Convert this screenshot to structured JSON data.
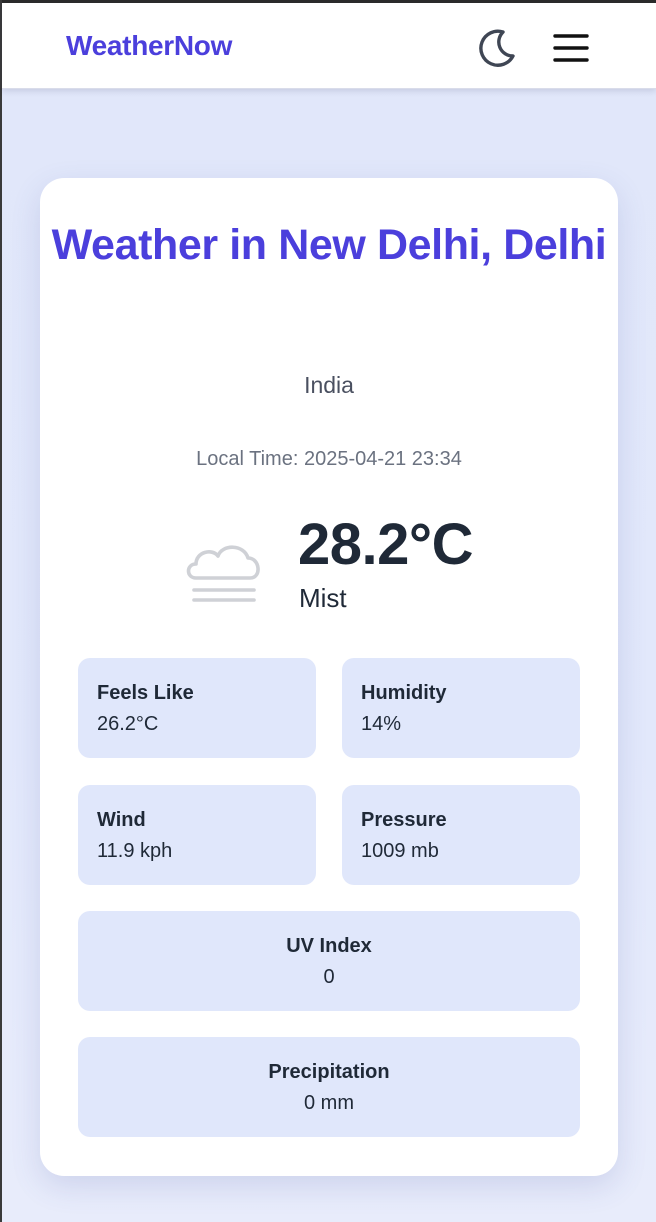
{
  "header": {
    "brand": "WeatherNow",
    "theme_toggle_icon": "moon-icon",
    "menu_icon": "hamburger-menu-icon"
  },
  "weather": {
    "title": "Weather in New Delhi, Delhi",
    "country": "India",
    "local_time": "Local Time: 2025-04-21 23:34",
    "temperature": "28.2°C",
    "condition": "Mist",
    "condition_icon": "mist-cloud-icon"
  },
  "stats": {
    "feels_like": {
      "label": "Feels Like",
      "value": "26.2°C"
    },
    "humidity": {
      "label": "Humidity",
      "value": "14%"
    },
    "wind": {
      "label": "Wind",
      "value": "11.9 kph"
    },
    "pressure": {
      "label": "Pressure",
      "value": "1009 mb"
    },
    "uv_index": {
      "label": "UV Index",
      "value": "0"
    },
    "precipitation": {
      "label": "Precipitation",
      "value": "0 mm"
    }
  },
  "colors": {
    "accent": "#4b3fdc",
    "page_background": "#e1e7fa",
    "stat_background": "#e0e7fb",
    "text_dark": "#1f2937",
    "text_muted": "#6b7280"
  }
}
